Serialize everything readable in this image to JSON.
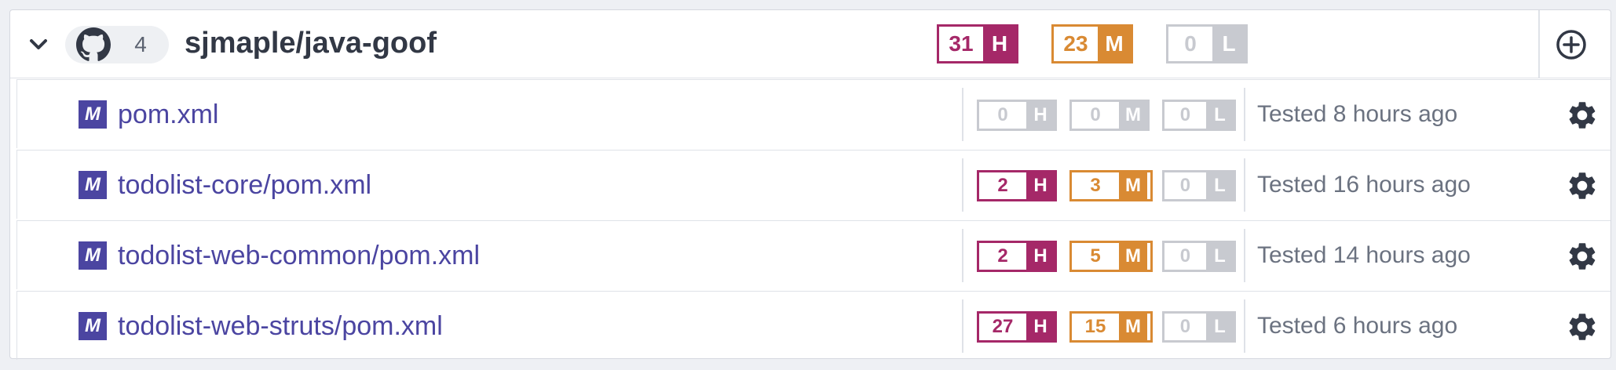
{
  "project": {
    "name": "sjmaple/java-goof",
    "target_count": "4",
    "source_icon": "github-icon",
    "counts": {
      "high": "31",
      "high_label": "H",
      "medium": "23",
      "medium_label": "M",
      "low": "0",
      "low_label": "L"
    }
  },
  "colors": {
    "high": "#a52868",
    "medium": "#d98a33",
    "low": "#c8cad0",
    "link": "#4b45a1",
    "title": "#323845",
    "muted": "#6b7280"
  },
  "files": [
    {
      "name": "pom.xml",
      "icon": "maven-icon",
      "icon_letter": "M",
      "high": "0",
      "high_label": "H",
      "medium": "0",
      "medium_label": "M",
      "low": "0",
      "low_label": "L",
      "tested": "Tested 8 hours ago"
    },
    {
      "name": "todolist-core/pom.xml",
      "icon": "maven-icon",
      "icon_letter": "M",
      "high": "2",
      "high_label": "H",
      "medium": "3",
      "medium_label": "M",
      "low": "0",
      "low_label": "L",
      "tested": "Tested 16 hours ago"
    },
    {
      "name": "todolist-web-common/pom.xml",
      "icon": "maven-icon",
      "icon_letter": "M",
      "high": "2",
      "high_label": "H",
      "medium": "5",
      "medium_label": "M",
      "low": "0",
      "low_label": "L",
      "tested": "Tested 14 hours ago"
    },
    {
      "name": "todolist-web-struts/pom.xml",
      "icon": "maven-icon",
      "icon_letter": "M",
      "high": "27",
      "high_label": "H",
      "medium": "15",
      "medium_label": "M",
      "low": "0",
      "low_label": "L",
      "tested": "Tested 6 hours ago"
    }
  ]
}
